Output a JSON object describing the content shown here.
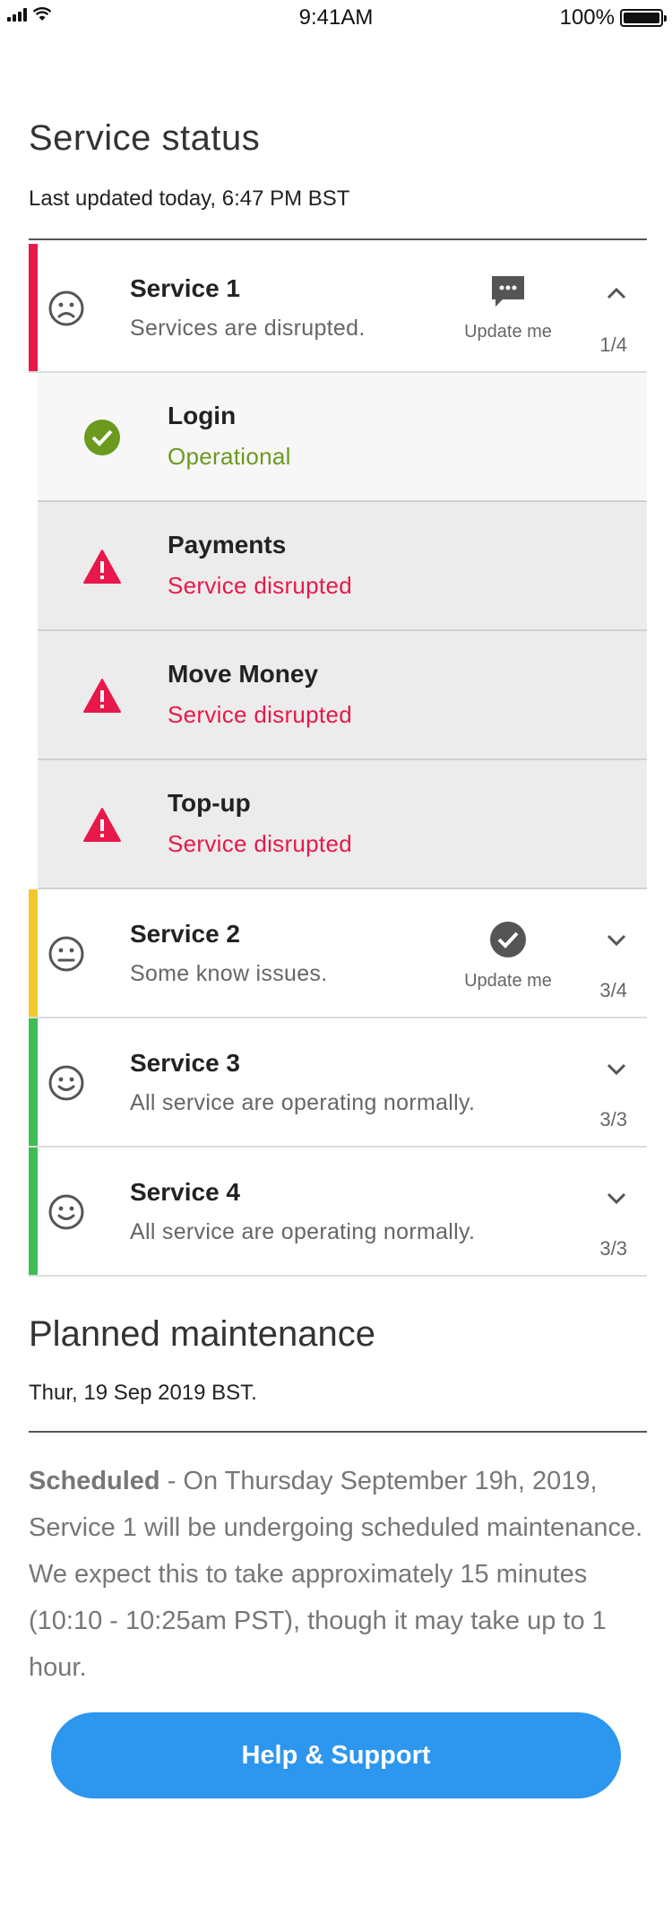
{
  "status_bar": {
    "time": "9:41AM",
    "battery": "100%"
  },
  "header": {
    "title": "Service status",
    "last_updated": "Last updated today, 6:47 PM BST"
  },
  "services": [
    {
      "name": "Service 1",
      "description": "Services are disrupted.",
      "notify_label": "Update me",
      "count": "1/4",
      "state_color": "#e8184a",
      "mood": "sad-face-icon",
      "expanded": true
    },
    {
      "name": "Service 2",
      "description": "Some know issues.",
      "notify_label": "Update me",
      "count": "3/4",
      "state_color": "#f2c82e",
      "mood": "neutral-face-icon",
      "expanded": false
    },
    {
      "name": "Service 3",
      "description": "All service are operating normally.",
      "count": "3/3",
      "state_color": "#3fbd55",
      "mood": "happy-face-icon",
      "expanded": false
    },
    {
      "name": "Service 4",
      "description": "All service are operating normally.",
      "count": "3/3",
      "state_color": "#3fbd55",
      "mood": "happy-face-icon",
      "expanded": false
    }
  ],
  "sub_services": [
    {
      "name": "Login",
      "status": "Operational",
      "status_color": "#6b9a1e",
      "icon": "check-circle-icon"
    },
    {
      "name": "Payments",
      "status": "Service disrupted",
      "status_color": "#e8184a",
      "icon": "warning-icon"
    },
    {
      "name": "Move Money",
      "status": "Service disrupted",
      "status_color": "#e8184a",
      "icon": "warning-icon"
    },
    {
      "name": "Top-up",
      "status": "Service disrupted",
      "status_color": "#e8184a",
      "icon": "warning-icon"
    }
  ],
  "maintenance": {
    "title": "Planned maintenance",
    "date": "Thur, 19 Sep 2019 BST.",
    "label": "Scheduled",
    "body": " - On Thursday September 19h, 2019, Service 1  will be undergoing scheduled maintenance. We expect this to take approximately 15 minutes (10:10 - 10:25am PST), though it may take up to 1 hour."
  },
  "help_button": {
    "label": "Help & Support",
    "color": "#2d96ee"
  }
}
